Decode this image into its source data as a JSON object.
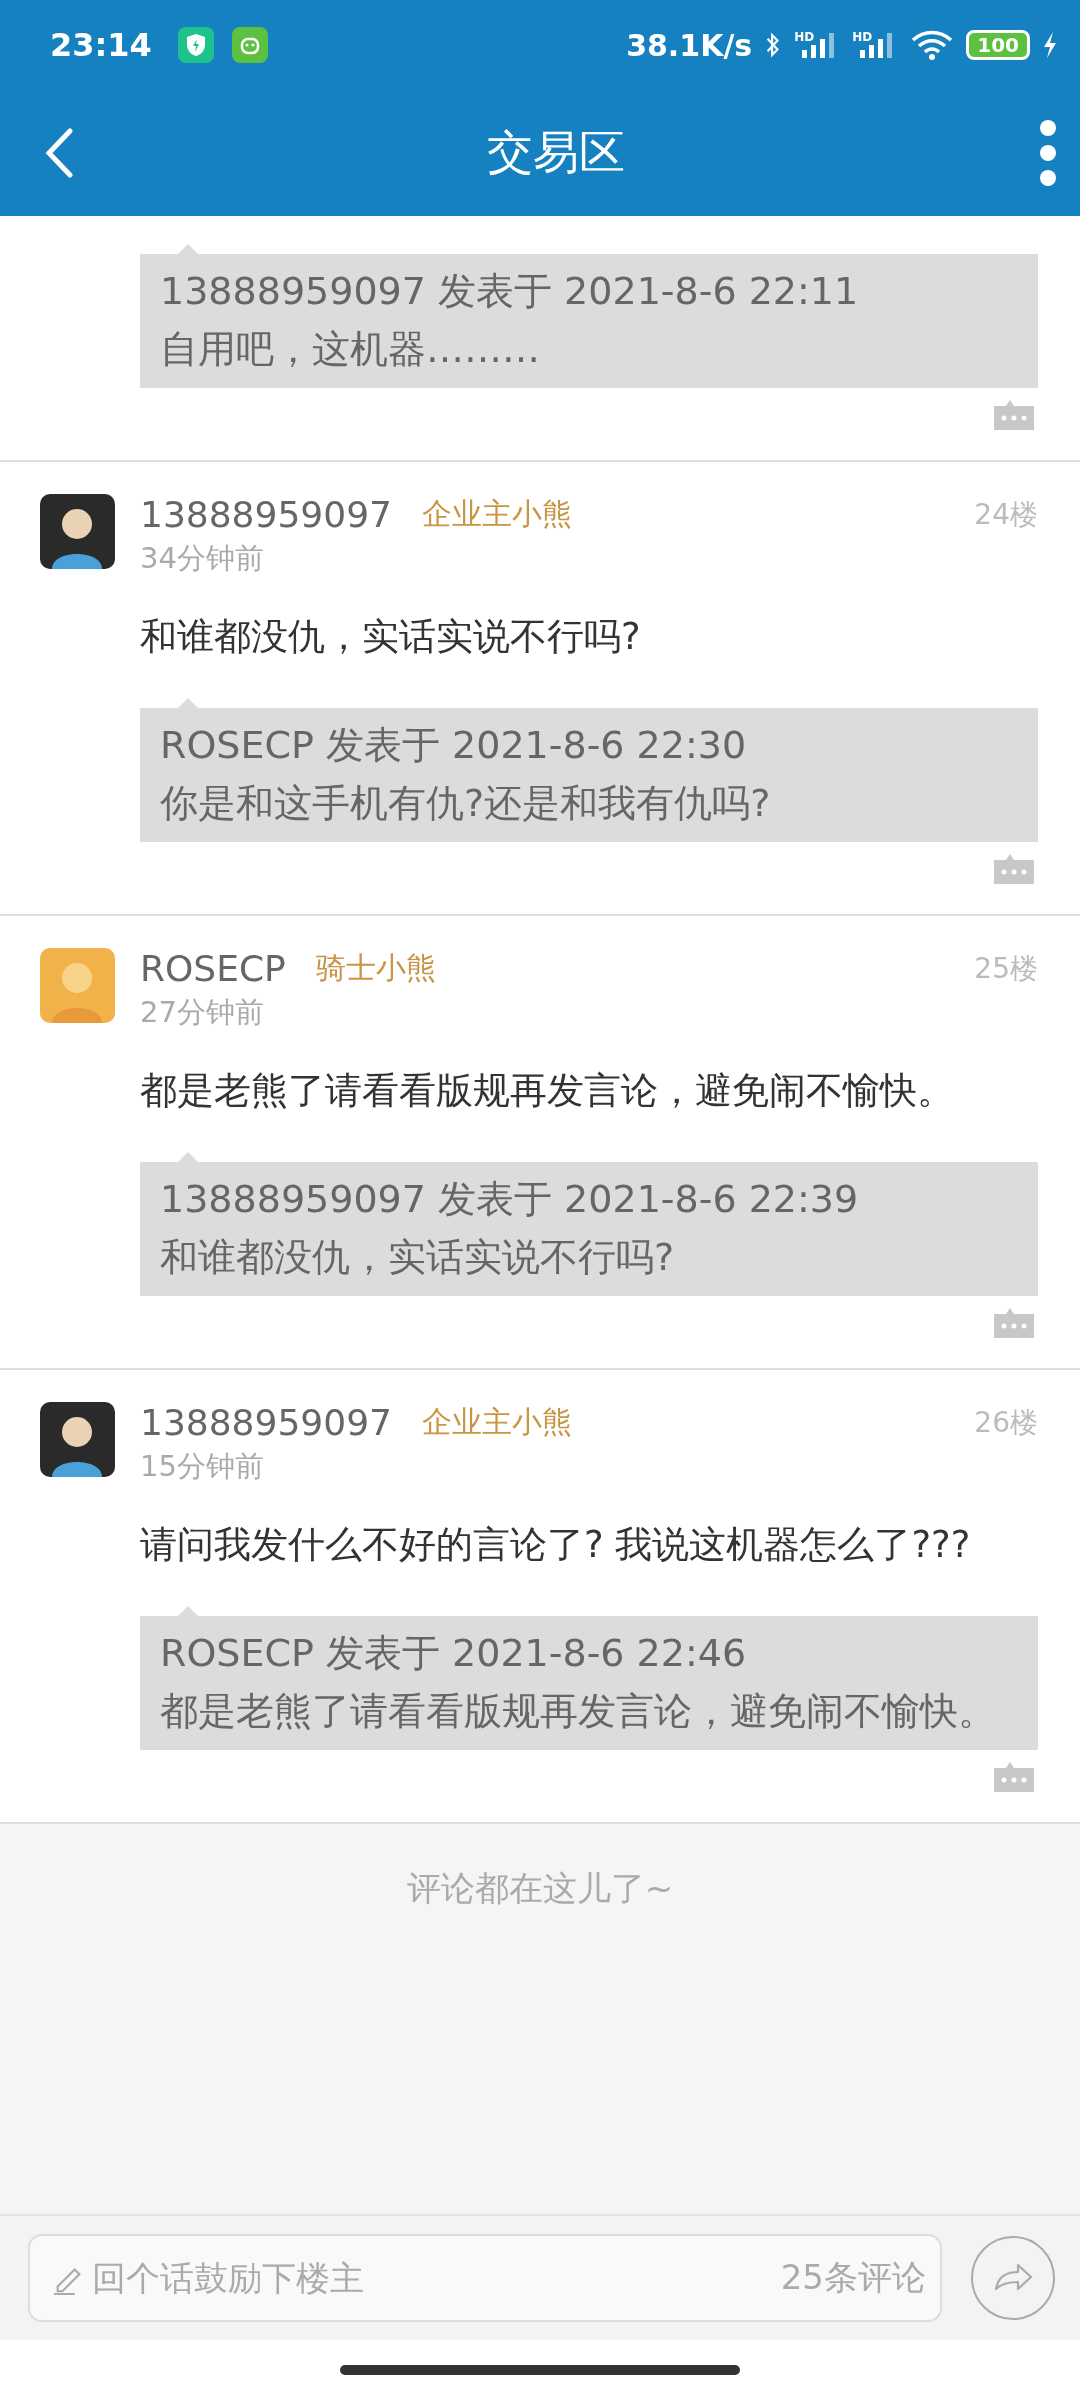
{
  "status_bar": {
    "time": "23:14",
    "speed": "38.1K/s",
    "signal_labels": [
      "HD",
      "HD"
    ],
    "battery": "100"
  },
  "app_bar": {
    "title": "交易区"
  },
  "posts": [
    {
      "kind": "partial",
      "quote": {
        "header": "13888959097 发表于 2021-8-6 22:11",
        "text": "自用吧，这机器………"
      }
    },
    {
      "kind": "full",
      "author": "13888959097",
      "badge": "企业主小熊",
      "floor": "24楼",
      "time": "34分钟前",
      "content": "和谁都没仇，实话实说不行吗?",
      "quote": {
        "header": "ROSECP 发表于 2021-8-6 22:30",
        "text": "你是和这手机有仇?还是和我有仇吗?"
      }
    },
    {
      "kind": "full",
      "author": "ROSECP",
      "badge": "骑士小熊",
      "floor": "25楼",
      "time": "27分钟前",
      "content": "都是老熊了请看看版规再发言论，避免闹不愉快。",
      "quote": {
        "header": "13888959097 发表于 2021-8-6 22:39",
        "text": "和谁都没仇，实话实说不行吗?"
      }
    },
    {
      "kind": "full",
      "author": "13888959097",
      "badge": "企业主小熊",
      "floor": "26楼",
      "time": "15分钟前",
      "content": "请问我发什么不好的言论了? 我说这机器怎么了???",
      "quote": {
        "header": "ROSECP 发表于 2021-8-6 22:46",
        "text": "都是老熊了请看看版规再发言论，避免闹不愉快。"
      }
    }
  ],
  "end_note": "评论都在这儿了~",
  "reply_bar": {
    "placeholder": "回个话鼓励下楼主",
    "count": "25条评论"
  }
}
